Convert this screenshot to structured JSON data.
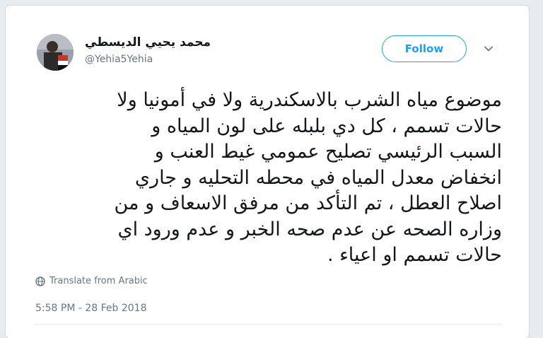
{
  "tweet": {
    "author_name": "محمد يحيي الديسطي",
    "author_handle": "@Yehia5Yehia",
    "follow_label": "Follow",
    "text": "موضوع مياه الشرب بالاسكندرية ولا في أمونيا  ولا\nحالات تسمم ، كل دي بلبله على لون المياه و\nالسبب الرئيسي تصليح عمومي غيط العنب و\nانخفاض معدل المياه في محطه التحليه و جاري\nاصلاح العطل ، تم التأكد من مرفق الاسعاف و من\nوزاره الصحه عن عدم صحه الخبر و عدم ورود اي\nحالات تسمم او اعياء .",
    "translate_label": "Translate from Arabic",
    "timestamp": "5:58 PM - 28 Feb 2018"
  },
  "colors": {
    "accent": "#1da1f2",
    "text": "#14171a",
    "muted": "#657786",
    "background": "#e6ecf0"
  },
  "icons": {
    "avatar": "avatar-photo",
    "more": "chevron-down-icon",
    "translate": "globe-icon"
  }
}
